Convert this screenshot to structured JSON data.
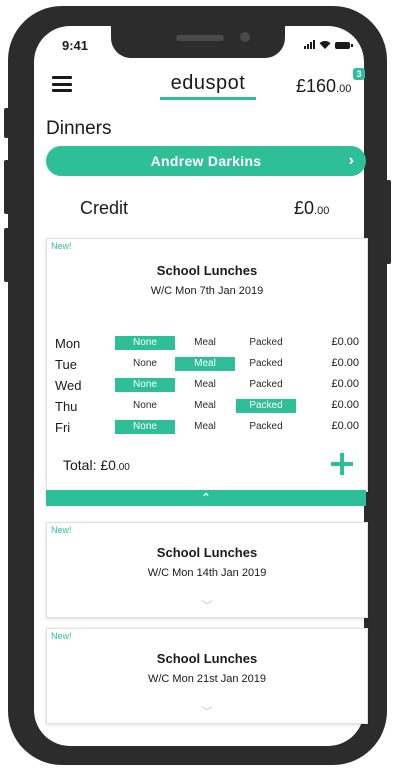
{
  "status_bar": {
    "time": "9:41"
  },
  "header": {
    "logo": "eduspot",
    "balance_main": "£160",
    "balance_dec": ".00",
    "notification_count": "3"
  },
  "page_title": "Dinners",
  "child_selector": {
    "name": "Andrew Darkins"
  },
  "credit": {
    "label": "Credit",
    "value_main": "£0",
    "value_dec": ".00"
  },
  "colors": {
    "accent": "#2fbf98",
    "phone_frame": "#2c2c2c"
  },
  "weeks": [
    {
      "badge": "New!",
      "title": "School Lunches",
      "week": "W/C Mon 7th Jan 2019",
      "rows": [
        {
          "day": "Mon",
          "none": "None",
          "meal": "Meal",
          "packed": "Packed",
          "selected": "none",
          "amount": "£0.00"
        },
        {
          "day": "Tue",
          "none": "None",
          "meal": "Meal",
          "packed": "Packed",
          "selected": "meal",
          "amount": "£0.00"
        },
        {
          "day": "Wed",
          "none": "None",
          "meal": "Meal",
          "packed": "Packed",
          "selected": "none",
          "amount": "£0.00"
        },
        {
          "day": "Thu",
          "none": "None",
          "meal": "Meal",
          "packed": "Packed",
          "selected": "packed",
          "amount": "£0.00"
        },
        {
          "day": "Fri",
          "none": "None",
          "meal": "Meal",
          "packed": "Packed",
          "selected": "none",
          "amount": "£0.00"
        }
      ],
      "total_main": "Total: £0",
      "total_dec": ".00",
      "collapse_icon": "chevron-up-icon"
    },
    {
      "badge": "New!",
      "title": "School Lunches",
      "week": "W/C Mon 14th Jan 2019",
      "expand_icon": "chevron-down-icon"
    },
    {
      "badge": "New!",
      "title": "School Lunches",
      "week": "W/C Mon 21st Jan 2019",
      "expand_icon": "chevron-down-icon"
    }
  ]
}
